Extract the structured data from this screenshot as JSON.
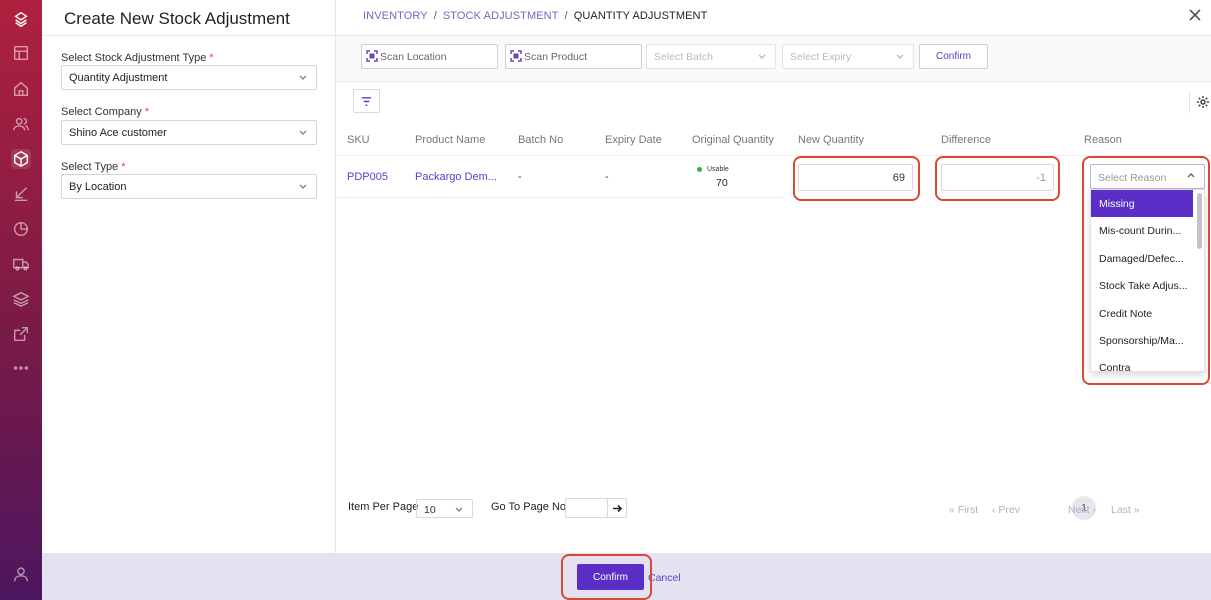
{
  "rail": {
    "icons": [
      "logo-icon",
      "dashboard-icon",
      "warehouse-icon",
      "users-icon",
      "cube-icon",
      "inbound-icon",
      "chart-icon",
      "truck-icon",
      "layers-icon",
      "external-icon",
      "more-icon",
      "profile-icon"
    ],
    "accent": "#b0213e"
  },
  "sidebar": {
    "title": "Create New Stock Adjustment",
    "type_label": "Select Stock Adjustment Type",
    "type_value": "Quantity Adjustment",
    "company_label": "Select Company",
    "company_value": "Shino Ace customer",
    "select_type_label": "Select Type",
    "select_type_value": "By Location",
    "required_mark": "*"
  },
  "breadcrumb": {
    "items": [
      "INVENTORY",
      "STOCK ADJUSTMENT",
      "QUANTITY ADJUSTMENT"
    ],
    "separator": "/"
  },
  "toolbar": {
    "scan_location": "Scan Location",
    "scan_product": "Scan Product",
    "batch_placeholder": "Select Batch",
    "expiry_placeholder": "Select Expiry",
    "confirm_label": "Confirm"
  },
  "table": {
    "headers": [
      "SKU",
      "Product Name",
      "Batch No",
      "Expiry Date",
      "Original Quantity",
      "New Quantity",
      "Difference",
      "Reason"
    ],
    "rows": [
      {
        "sku": "PDP005",
        "product": "Packargo Dem...",
        "batch": "-",
        "expiry": "-",
        "qty_status": "Usable",
        "qty": "70",
        "new_qty": "69",
        "difference": "-1",
        "reason_placeholder": "Select Reason"
      }
    ]
  },
  "reason_options": [
    "Missing",
    "Mis-count Durin...",
    "Damaged/Defec...",
    "Stock Take Adjus...",
    "Credit Note",
    "Sponsorship/Ma...",
    "Contra"
  ],
  "pagination": {
    "per_page_label": "Item Per Page",
    "per_page_value": "10",
    "goto_label": "Go To Page No.",
    "first": "First",
    "prev": "Prev",
    "current": "1",
    "next": "Next",
    "last": "Last"
  },
  "footer": {
    "confirm": "Confirm",
    "cancel": "Cancel"
  },
  "colors": {
    "primary": "#5b2fc7",
    "highlight": "#d64a34",
    "status_usable": "#2fb344"
  }
}
